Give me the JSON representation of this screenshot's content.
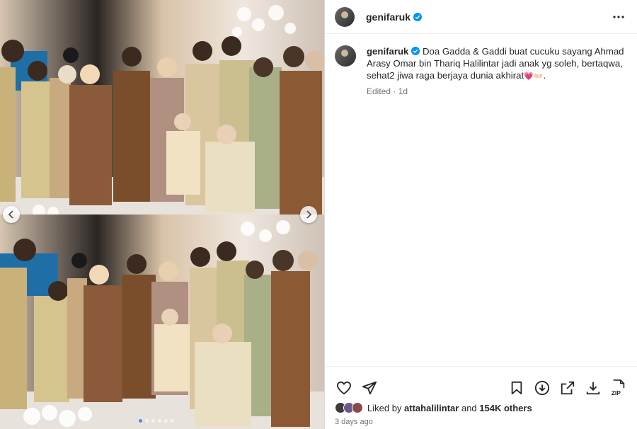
{
  "post": {
    "username": "genifaruk",
    "verified": true,
    "caption": "Doa Gadda & Gaddi buat cucuku sayang Ahmad Arasy Omar bin Thariq Halilintar jadi anak yg soleh, bertaqwa, sehat2 jiwa raga berjaya dunia akhirat",
    "caption_emojis": "💗👐🏻",
    "caption_end": ".",
    "edited_label": "Edited",
    "age": "1d"
  },
  "likes": {
    "prefix": "Liked by",
    "user": "attahalilintar",
    "conjunction": "and",
    "others": "154K others"
  },
  "timestamp": "3 days ago",
  "carousel": {
    "slide_count": 6,
    "active_index": 0
  },
  "colors": {
    "verified": "#0095f6",
    "active_dot": "#4a90e2",
    "heart": "#e1306c"
  },
  "icons": [
    "more-icon",
    "heart-icon",
    "share-icon",
    "bookmark-icon",
    "download-circle-icon",
    "open-external-icon",
    "download-icon",
    "zip-icon"
  ],
  "zip_label": "ZIP"
}
